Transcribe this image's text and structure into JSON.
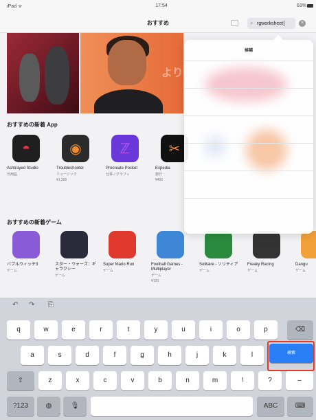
{
  "status": {
    "left": "iPad ᯤ",
    "time": "17:54",
    "right": "63%"
  },
  "nav": {
    "title": "おすすめ",
    "search_value": "rgworksheet"
  },
  "banner": {
    "text": "より"
  },
  "sections": {
    "new_apps": "おすすめの新着 App",
    "new_games": "おすすめの新着ゲーム"
  },
  "apps": [
    {
      "name": "Ashtrayed Studio",
      "sub": "日用品",
      "color": "#1f1f1f",
      "glyph": "◓",
      "accent": "#e8324e"
    },
    {
      "name": "Troubleshooter",
      "sub": "ミュージック",
      "sub2": "¥1,200",
      "color": "#2b2b2b",
      "glyph": "◉",
      "accent": "#f08a2a"
    },
    {
      "name": "Procreate Pocket",
      "sub": "仕事ノグラフィ",
      "color": "#6a37d8",
      "glyph": "ℤ",
      "accent": "#b95cf5"
    },
    {
      "name": "Expedia",
      "sub": "旅行",
      "sub2": "¥400",
      "color": "#111",
      "glyph": "✂",
      "accent": "#f08a2a"
    }
  ],
  "games": [
    {
      "name": "バブルウィッチ3",
      "sub": "ゲーム",
      "color": "#8a5bd6"
    },
    {
      "name": "スター・ウォーズ：ギャラクシー",
      "sub": "ゲーム",
      "color": "#2a2a3a"
    },
    {
      "name": "Super Mario Run",
      "sub": "ゲーム",
      "color": "#e03a2e"
    },
    {
      "name": "Football Games - Multiplayer",
      "sub": "ゲーム",
      "sub2": "¥120",
      "color": "#3e86d6"
    },
    {
      "name": "Solitaire - ソリティア",
      "sub": "ゲーム",
      "color": "#2a8a3e"
    },
    {
      "name": "Freaky Racing",
      "sub": "ゲーム",
      "color": "#333"
    },
    {
      "name": "Dangu",
      "sub": "ゲーム",
      "color": "#f2a03a"
    }
  ],
  "popover": {
    "title": "候補"
  },
  "keyboard": {
    "row1": [
      "q",
      "w",
      "e",
      "r",
      "t",
      "y",
      "u",
      "i",
      "o",
      "p"
    ],
    "row2": [
      "a",
      "s",
      "d",
      "f",
      "g",
      "h",
      "j",
      "k",
      "l"
    ],
    "row3": [
      "z",
      "x",
      "c",
      "v",
      "b",
      "n",
      "m",
      "!",
      "?"
    ],
    "search_label": "検索",
    "numbers_label": "?123",
    "abc_label": "ABC"
  }
}
